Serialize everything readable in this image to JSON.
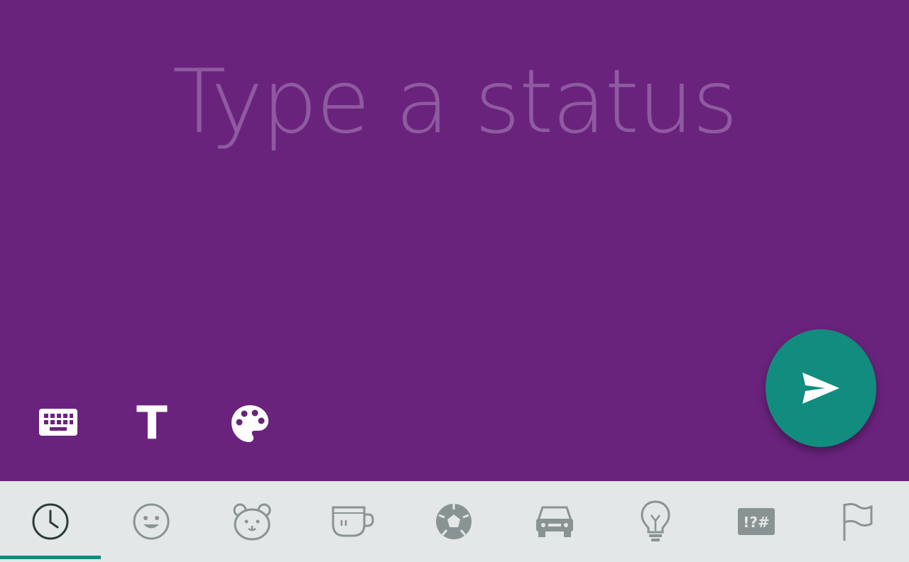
{
  "status_input": {
    "placeholder": "Type a status"
  },
  "toolbar": {
    "keyboard_icon": "keyboard-icon",
    "text_label": "T",
    "palette_icon": "palette-icon"
  },
  "send_button": {
    "icon": "send-icon"
  },
  "emoji_tabs": [
    {
      "icon": "recent-clock-icon",
      "selected": true
    },
    {
      "icon": "smiley-icon",
      "selected": false
    },
    {
      "icon": "animal-bear-icon",
      "selected": false
    },
    {
      "icon": "food-cup-icon",
      "selected": false
    },
    {
      "icon": "activity-soccer-icon",
      "selected": false
    },
    {
      "icon": "travel-car-icon",
      "selected": false
    },
    {
      "icon": "objects-lightbulb-icon",
      "selected": false
    },
    {
      "icon": "symbols-icon",
      "label": "!?#",
      "selected": false
    },
    {
      "icon": "flags-icon",
      "selected": false
    }
  ],
  "colors": {
    "background": "#6a237d",
    "placeholder": "#8e5aa0",
    "accent": "#128c7e",
    "bar": "#e3e7e7",
    "icon_gray": "#8a9394"
  }
}
